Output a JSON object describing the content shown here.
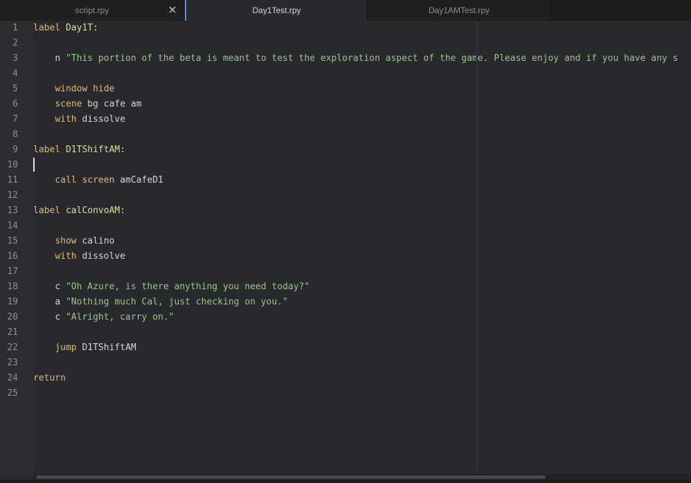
{
  "tabs": [
    {
      "label": "script.rpy",
      "active": false,
      "close_icon": "close-icon"
    },
    {
      "label": "Day1Test.rpy",
      "active": true
    },
    {
      "label": "Day1AMTest.rpy",
      "active": false
    }
  ],
  "editor": {
    "line_numbers": [
      "1",
      "2",
      "3",
      "4",
      "5",
      "6",
      "7",
      "8",
      "9",
      "10",
      "11",
      "12",
      "13",
      "14",
      "15",
      "16",
      "17",
      "18",
      "19",
      "20",
      "21",
      "22",
      "23",
      "24",
      "25"
    ],
    "current_line": "10",
    "lines": {
      "l1": {
        "kw": "label",
        "rest": "Day1T:"
      },
      "l3": {
        "speaker": "n",
        "string": "\"This portion of the beta is meant to test the exploration aspect of the game. Please enjoy and if you have any s"
      },
      "l5": {
        "kw": "window hide"
      },
      "l6": {
        "kw": "scene",
        "rest": "bg cafe am"
      },
      "l7": {
        "kw": "with",
        "rest": "dissolve"
      },
      "l9": {
        "kw": "label",
        "rest": "D1TShiftAM:"
      },
      "l11": {
        "kw": "call screen",
        "rest": "amCafeD1"
      },
      "l13": {
        "kw": "label",
        "rest": "calConvoAM:"
      },
      "l15": {
        "kw": "show",
        "rest": "calino"
      },
      "l16": {
        "kw": "with",
        "rest": "dissolve"
      },
      "l18": {
        "speaker": "c",
        "string": "\"Oh Azure, is there anything you need today?\""
      },
      "l19": {
        "speaker": "a",
        "string": "\"Nothing much Cal, just checking on you.\""
      },
      "l20": {
        "speaker": "c",
        "string": "\"Alright, carry on.\""
      },
      "l22": {
        "kw": "jump",
        "rest": "D1TShiftAM"
      },
      "l24": {
        "kw": "return"
      }
    }
  },
  "colors": {
    "background": "#27292c",
    "keyword": "#e7b86a",
    "string": "#9ac786",
    "label_name": "#e3dc9b",
    "active_tab_accent": "#5b95d6"
  }
}
